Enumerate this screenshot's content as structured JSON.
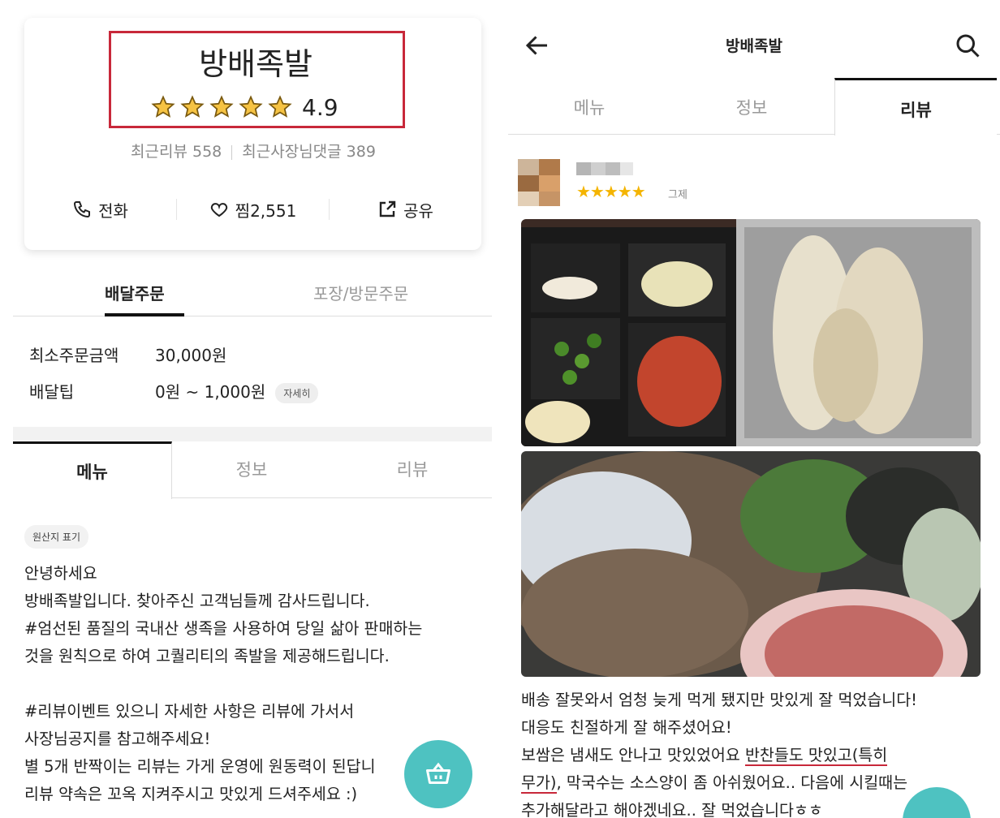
{
  "left": {
    "store_name": "방배족발",
    "rating": "4.9",
    "recent_reviews": "최근리뷰 558",
    "recent_owner_replies": "최근사장님댓글 389",
    "actions": {
      "call": "전화",
      "like": "찜2,551",
      "share": "공유"
    },
    "order_tabs": {
      "delivery": "배달주문",
      "pickup": "포장/방문주문"
    },
    "min_order_label": "최소주문금액",
    "min_order_value": "30,000원",
    "delivery_tip_label": "배달팁",
    "delivery_tip_value": "0원 ~ 1,000원",
    "detail_chip": "자세히",
    "tabs": {
      "menu": "메뉴",
      "info": "정보",
      "review": "리뷰"
    },
    "origin_chip": "원산지 표기",
    "notice_lines": [
      "안녕하세요",
      "방배족발입니다. 찾아주신 고객님들께 감사드립니다.",
      "#엄선된 품질의 국내산 생족을 사용하여 당일 삶아 판매하는",
      "것을 원칙으로 하여 고퀄리티의 족발을 제공해드립니다.",
      "",
      "#리뷰이벤트 있으니 자세한 사항은 리뷰에 가서서",
      "사장님공지를 참고해주세요!",
      "별 5개 반짝이는 리뷰는 가게 운영에 원동력이 된답니",
      "리뷰 약속은 꼬옥 지켜주시고 맛있게 드셔주세요 :)"
    ]
  },
  "right": {
    "title": "방배족발",
    "tabs": {
      "menu": "메뉴",
      "info": "정보",
      "review": "리뷰"
    },
    "review_stars": "★★★★★",
    "review_rating": 5,
    "review_date": "그제",
    "review_lines": {
      "l1": "배송 잘못와서 엄청 늦게 먹게 됐지만 맛있게 잘 먹었습니다!",
      "l2": "대응도 친절하게 잘 해주셨어요!",
      "l3a": "보쌈은 냄새도 안나고 맛있었어요 ",
      "l3b": "반찬들도 맛있고(특히",
      "l4a": "무가)",
      "l4b": ", 막국수는 소스양이 좀 아쉬웠어요.. 다음에 시킬때는",
      "l5": "추가해달라고 해야겠네요.. 잘 먹었습니다ㅎㅎ"
    }
  },
  "colors": {
    "accent_teal": "#4ec2c1",
    "highlight_red": "#c8283a",
    "star_gold": "#f4b400"
  }
}
